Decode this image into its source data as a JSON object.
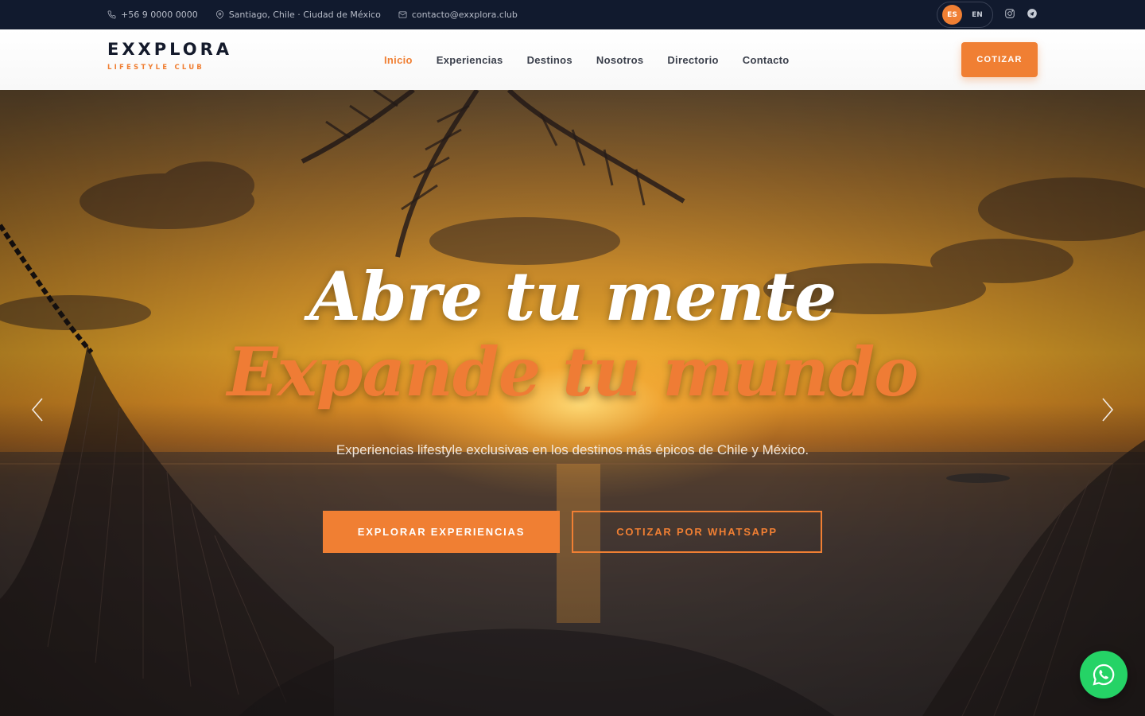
{
  "topbar": {
    "phone": "+56 9 0000 0000",
    "location": "Santiago, Chile · Ciudad de México",
    "email": "contacto@exxplora.club",
    "lang_active": "ES",
    "lang_other": "EN"
  },
  "header": {
    "brand": "EXXPLORA",
    "tagline": "LIFESTYLE CLUB",
    "nav": [
      "Inicio",
      "Experiencias",
      "Destinos",
      "Nosotros",
      "Directorio",
      "Contacto"
    ],
    "cta": "COTIZAR"
  },
  "hero": {
    "headline_1": "Abre tu mente",
    "headline_2": "Expande tu mundo",
    "subtitle": "Experiencias lifestyle exclusivas en los destinos más épicos de Chile y México.",
    "primary_button": "EXPLORAR EXPERIENCIAS",
    "secondary_button": "COTIZAR POR WHATSAPP"
  },
  "colors": {
    "accent": "#f07f33",
    "topbar_bg": "#111a2e",
    "whatsapp": "#25d366"
  },
  "icons": [
    "phone-icon",
    "location-pin-icon",
    "mail-icon",
    "instagram-icon",
    "telegram-icon",
    "chevron-left-icon",
    "chevron-right-icon",
    "whatsapp-icon"
  ]
}
